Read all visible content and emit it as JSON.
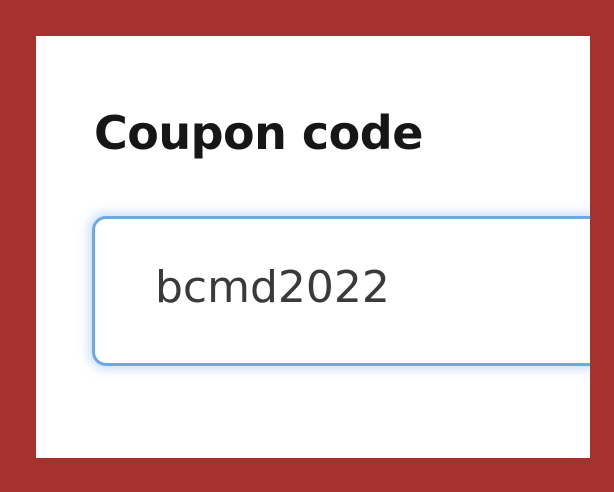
{
  "form": {
    "coupon_label": "Coupon code",
    "coupon_value": "bcmd2022",
    "coupon_placeholder": ""
  },
  "colors": {
    "frame_border": "#a5322f",
    "focus_ring": "#6aa9e8",
    "background": "#ffffff"
  }
}
